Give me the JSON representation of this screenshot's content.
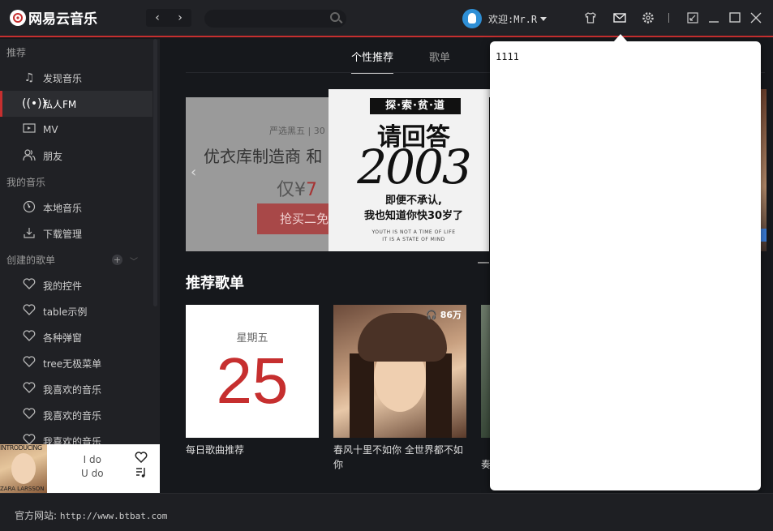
{
  "app": {
    "logo_text": "网易云音乐",
    "logo_mark": "⑥"
  },
  "topbar": {
    "nav_back": "‹",
    "nav_forward": "›",
    "user_name": "欢迎:Mr.R",
    "icons": [
      "shirt-icon",
      "mail-icon",
      "gear-icon",
      "minimize-to-mini-icon",
      "minimize-icon",
      "maximize-icon",
      "close-icon"
    ]
  },
  "sidebar": {
    "sections": {
      "recommend": "推荐",
      "my_music": "我的音乐",
      "created": "创建的歌单"
    },
    "items": [
      {
        "label": "发现音乐",
        "icon": "music-note-icon"
      },
      {
        "label": "私人FM",
        "icon": "radio-icon",
        "active": true
      },
      {
        "label": "MV",
        "icon": "video-icon"
      },
      {
        "label": "朋友",
        "icon": "friends-icon"
      },
      {
        "label": "本地音乐",
        "icon": "disc-icon"
      },
      {
        "label": "下载管理",
        "icon": "download-icon"
      },
      {
        "label": "我的控件",
        "icon": "heart-icon"
      },
      {
        "label": "table示例",
        "icon": "heart-icon"
      },
      {
        "label": "各种弹窗",
        "icon": "heart-icon"
      },
      {
        "label": "tree无极菜单",
        "icon": "heart-icon"
      },
      {
        "label": "我喜欢的音乐",
        "icon": "heart-icon"
      },
      {
        "label": "我喜欢的音乐",
        "icon": "heart-icon"
      },
      {
        "label": "我喜欢的音乐",
        "icon": "heart-icon"
      }
    ]
  },
  "player": {
    "cover_top": "INTRODUCING",
    "cover_bottom": "ZARA LARSSON",
    "line1": "I do",
    "line2": "U do"
  },
  "main": {
    "tabs": [
      {
        "label": "个性推荐",
        "active": true
      },
      {
        "label": "歌单",
        "active": false
      }
    ],
    "banner": {
      "left_line1": "严选黑五 | 30",
      "left_line2": "优衣库制造商 和",
      "left_price_prefix": "仅¥",
      "left_price": "7",
      "left_button": "抢买二免",
      "center_tag": "探·索·贫·道",
      "center_title": "请回答",
      "center_year": "2003",
      "center_sub1": "即便不承认,",
      "center_sub2": "我也知道你快30岁了",
      "center_en1": "YOUTH IS NOT A TIME OF LIFE",
      "center_en2": "IT IS A STATE OF MIND"
    },
    "section_title": "推荐歌单",
    "cards": [
      {
        "weekday": "星期五",
        "day": "25",
        "title": "每日歌曲推荐"
      },
      {
        "plays": "86万",
        "title": "春风十里不如你 全世界都不如你"
      },
      {
        "title": "奏"
      }
    ]
  },
  "popup": {
    "text": "1111"
  },
  "footer": {
    "label": "官方网站:",
    "url": "http://www.btbat.com"
  }
}
